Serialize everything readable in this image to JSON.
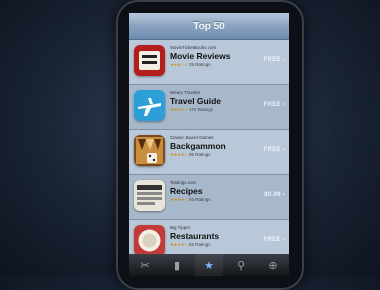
{
  "nav": {
    "title": "Top 50"
  },
  "apps": [
    {
      "developer": "MovieTicketBooks.com",
      "name": "Movie Reviews",
      "stars": "★★★☆☆",
      "reviews": "25 Ratings",
      "price": "FREE ›",
      "icon": "movie-reviews-icon"
    },
    {
      "developer": "Weary Traveler",
      "name": "Travel Guide",
      "stars": "★★★★☆",
      "reviews": "172 Ratings",
      "price": "FREE ›",
      "icon": "airplane-icon"
    },
    {
      "developer": "Classic Board Games",
      "name": "Backgammon",
      "stars": "★★★★☆",
      "reviews": "85 Ratings",
      "price": "FREE ›",
      "icon": "backgammon-icon"
    },
    {
      "developer": "Tastings.com",
      "name": "Recipes",
      "stars": "★★★★☆",
      "reviews": "93 Ratings",
      "price": "$0.99 ›",
      "icon": "recipes-icon"
    },
    {
      "developer": "Big Tipper",
      "name": "Restaurants",
      "stars": "★★★★☆",
      "reviews": "62 Ratings",
      "price": "FREE ›",
      "icon": "plate-icon"
    }
  ],
  "tabbar": {
    "tabs": [
      {
        "icon": "featured-icon",
        "glyph": "✂"
      },
      {
        "icon": "categories-icon",
        "glyph": "▮"
      },
      {
        "icon": "star-icon",
        "glyph": "★"
      },
      {
        "icon": "search-icon",
        "glyph": "⚲"
      },
      {
        "icon": "updates-icon",
        "glyph": "⊕"
      }
    ],
    "active": 2
  }
}
